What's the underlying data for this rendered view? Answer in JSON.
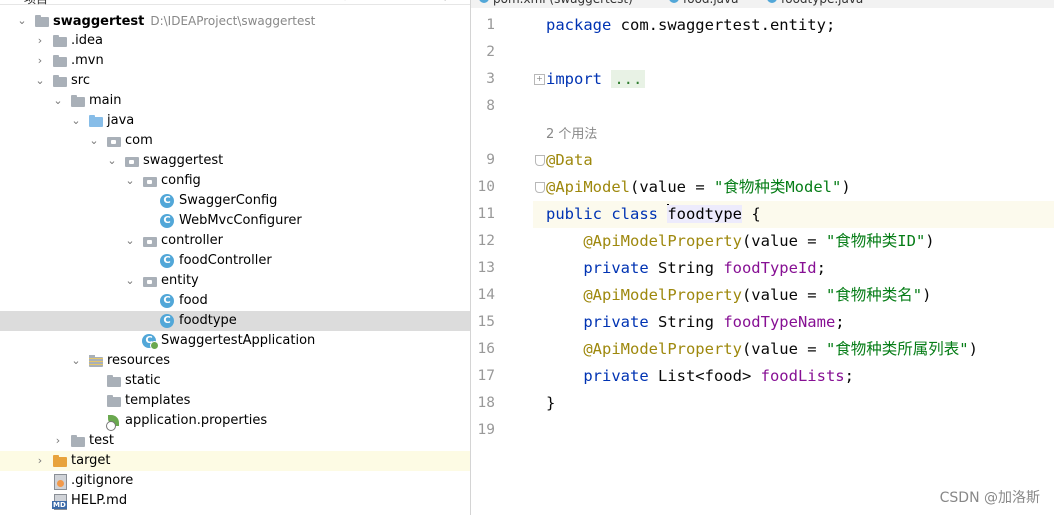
{
  "project_panel": {
    "header": {
      "title": "项目",
      "tools": "⊕ ≑ ⚙"
    },
    "tree": [
      {
        "label": "swaggertest",
        "path": "D:\\IDEAProject\\swaggertest",
        "icon": "module-folder-icon",
        "expanded": true,
        "bold": true
      },
      {
        "label": ".idea",
        "icon": "folder-icon",
        "expanded": false
      },
      {
        "label": ".mvn",
        "icon": "folder-icon",
        "expanded": false
      },
      {
        "label": "src",
        "icon": "folder-icon",
        "expanded": true
      },
      {
        "label": "main",
        "icon": "folder-icon",
        "expanded": true
      },
      {
        "label": "java",
        "icon": "source-root-folder-icon",
        "expanded": true
      },
      {
        "label": "com",
        "icon": "package-icon",
        "expanded": true
      },
      {
        "label": "swaggertest",
        "icon": "package-icon",
        "expanded": true
      },
      {
        "label": "config",
        "icon": "package-icon",
        "expanded": true
      },
      {
        "label": "SwaggerConfig",
        "icon": "java-class-icon"
      },
      {
        "label": "WebMvcConfigurer",
        "icon": "java-class-icon"
      },
      {
        "label": "controller",
        "icon": "package-icon",
        "expanded": true
      },
      {
        "label": "foodController",
        "icon": "java-class-icon"
      },
      {
        "label": "entity",
        "icon": "package-icon",
        "expanded": true
      },
      {
        "label": "food",
        "icon": "java-class-icon"
      },
      {
        "label": "foodtype",
        "icon": "java-class-icon",
        "selected": true
      },
      {
        "label": "SwaggertestApplication",
        "icon": "spring-boot-class-icon"
      },
      {
        "label": "resources",
        "icon": "resources-folder-icon",
        "expanded": true
      },
      {
        "label": "static",
        "icon": "folder-icon"
      },
      {
        "label": "templates",
        "icon": "folder-icon"
      },
      {
        "label": "application.properties",
        "icon": "spring-properties-icon"
      },
      {
        "label": "test",
        "icon": "folder-icon",
        "expanded": false
      },
      {
        "label": "target",
        "icon": "excluded-folder-icon",
        "expanded": false
      },
      {
        "label": ".gitignore",
        "icon": "gitignore-file-icon"
      },
      {
        "label": "HELP.md",
        "icon": "markdown-file-icon"
      }
    ]
  },
  "editor_tabs": [
    {
      "label": "pom.xml (swaggertest)",
      "icon": "maven-icon"
    },
    {
      "label": "food.java",
      "icon": "java-class-icon"
    },
    {
      "label": "foodtype.java",
      "icon": "java-class-icon",
      "active": true
    }
  ],
  "editor": {
    "lines": [
      {
        "num": "1",
        "tokens": [
          {
            "t": "package ",
            "c": "kw"
          },
          {
            "t": "com.swaggertest.entity;",
            "c": "plain"
          }
        ]
      },
      {
        "num": "2",
        "tokens": []
      },
      {
        "num": "3",
        "fold": "plus",
        "tokens": [
          {
            "t": "import ",
            "c": "kw"
          },
          {
            "t": "...",
            "c": "folded-dots"
          }
        ]
      },
      {
        "num": "8",
        "tokens": []
      },
      {
        "num": "",
        "tokens": [
          {
            "t": "2 个用法",
            "c": "usage"
          }
        ]
      },
      {
        "num": "9",
        "fold": "shield",
        "tokens": [
          {
            "t": "@Data",
            "c": "ann"
          }
        ]
      },
      {
        "num": "10",
        "fold": "shield",
        "tokens": [
          {
            "t": "@ApiModel",
            "c": "ann"
          },
          {
            "t": "(value = ",
            "c": "plain"
          },
          {
            "t": "\"食物种类Model\"",
            "c": "str"
          },
          {
            "t": ")",
            "c": "plain"
          }
        ]
      },
      {
        "num": "11",
        "current": true,
        "tokens": [
          {
            "t": "public class ",
            "c": "kw"
          },
          {
            "t": "",
            "c": "caret"
          },
          {
            "t": "foodtype",
            "c": "caret-word"
          },
          {
            "t": " {",
            "c": "plain"
          }
        ]
      },
      {
        "num": "12",
        "tokens": [
          {
            "t": "    ",
            "c": "plain"
          },
          {
            "t": "@ApiModelProperty",
            "c": "ann"
          },
          {
            "t": "(value = ",
            "c": "plain"
          },
          {
            "t": "\"食物种类ID\"",
            "c": "str"
          },
          {
            "t": ")",
            "c": "plain"
          }
        ]
      },
      {
        "num": "13",
        "tokens": [
          {
            "t": "    ",
            "c": "plain"
          },
          {
            "t": "private ",
            "c": "kw"
          },
          {
            "t": "String ",
            "c": "plain"
          },
          {
            "t": "foodTypeId",
            "c": "field"
          },
          {
            "t": ";",
            "c": "plain"
          }
        ]
      },
      {
        "num": "14",
        "tokens": [
          {
            "t": "    ",
            "c": "plain"
          },
          {
            "t": "@ApiModelProperty",
            "c": "ann"
          },
          {
            "t": "(value = ",
            "c": "plain"
          },
          {
            "t": "\"食物种类名\"",
            "c": "str"
          },
          {
            "t": ")",
            "c": "plain"
          }
        ]
      },
      {
        "num": "15",
        "tokens": [
          {
            "t": "    ",
            "c": "plain"
          },
          {
            "t": "private ",
            "c": "kw"
          },
          {
            "t": "String ",
            "c": "plain"
          },
          {
            "t": "foodTypeName",
            "c": "field"
          },
          {
            "t": ";",
            "c": "plain"
          }
        ]
      },
      {
        "num": "16",
        "tokens": [
          {
            "t": "    ",
            "c": "plain"
          },
          {
            "t": "@ApiModelProperty",
            "c": "ann"
          },
          {
            "t": "(value = ",
            "c": "plain"
          },
          {
            "t": "\"食物种类所属列表\"",
            "c": "str"
          },
          {
            "t": ")",
            "c": "plain"
          }
        ]
      },
      {
        "num": "17",
        "tokens": [
          {
            "t": "    ",
            "c": "plain"
          },
          {
            "t": "private ",
            "c": "kw"
          },
          {
            "t": "List<food> ",
            "c": "plain"
          },
          {
            "t": "foodLists",
            "c": "field"
          },
          {
            "t": ";",
            "c": "plain"
          }
        ]
      },
      {
        "num": "18",
        "tokens": [
          {
            "t": "}",
            "c": "plain"
          }
        ]
      },
      {
        "num": "19",
        "tokens": []
      }
    ]
  },
  "watermark": "CSDN @加洛斯",
  "colors": {
    "keyword": "#0033b3",
    "annotation": "#9e880d",
    "string": "#067d17",
    "field": "#871094",
    "selection": "#dcdcdc",
    "current_line": "#fcfaed"
  }
}
